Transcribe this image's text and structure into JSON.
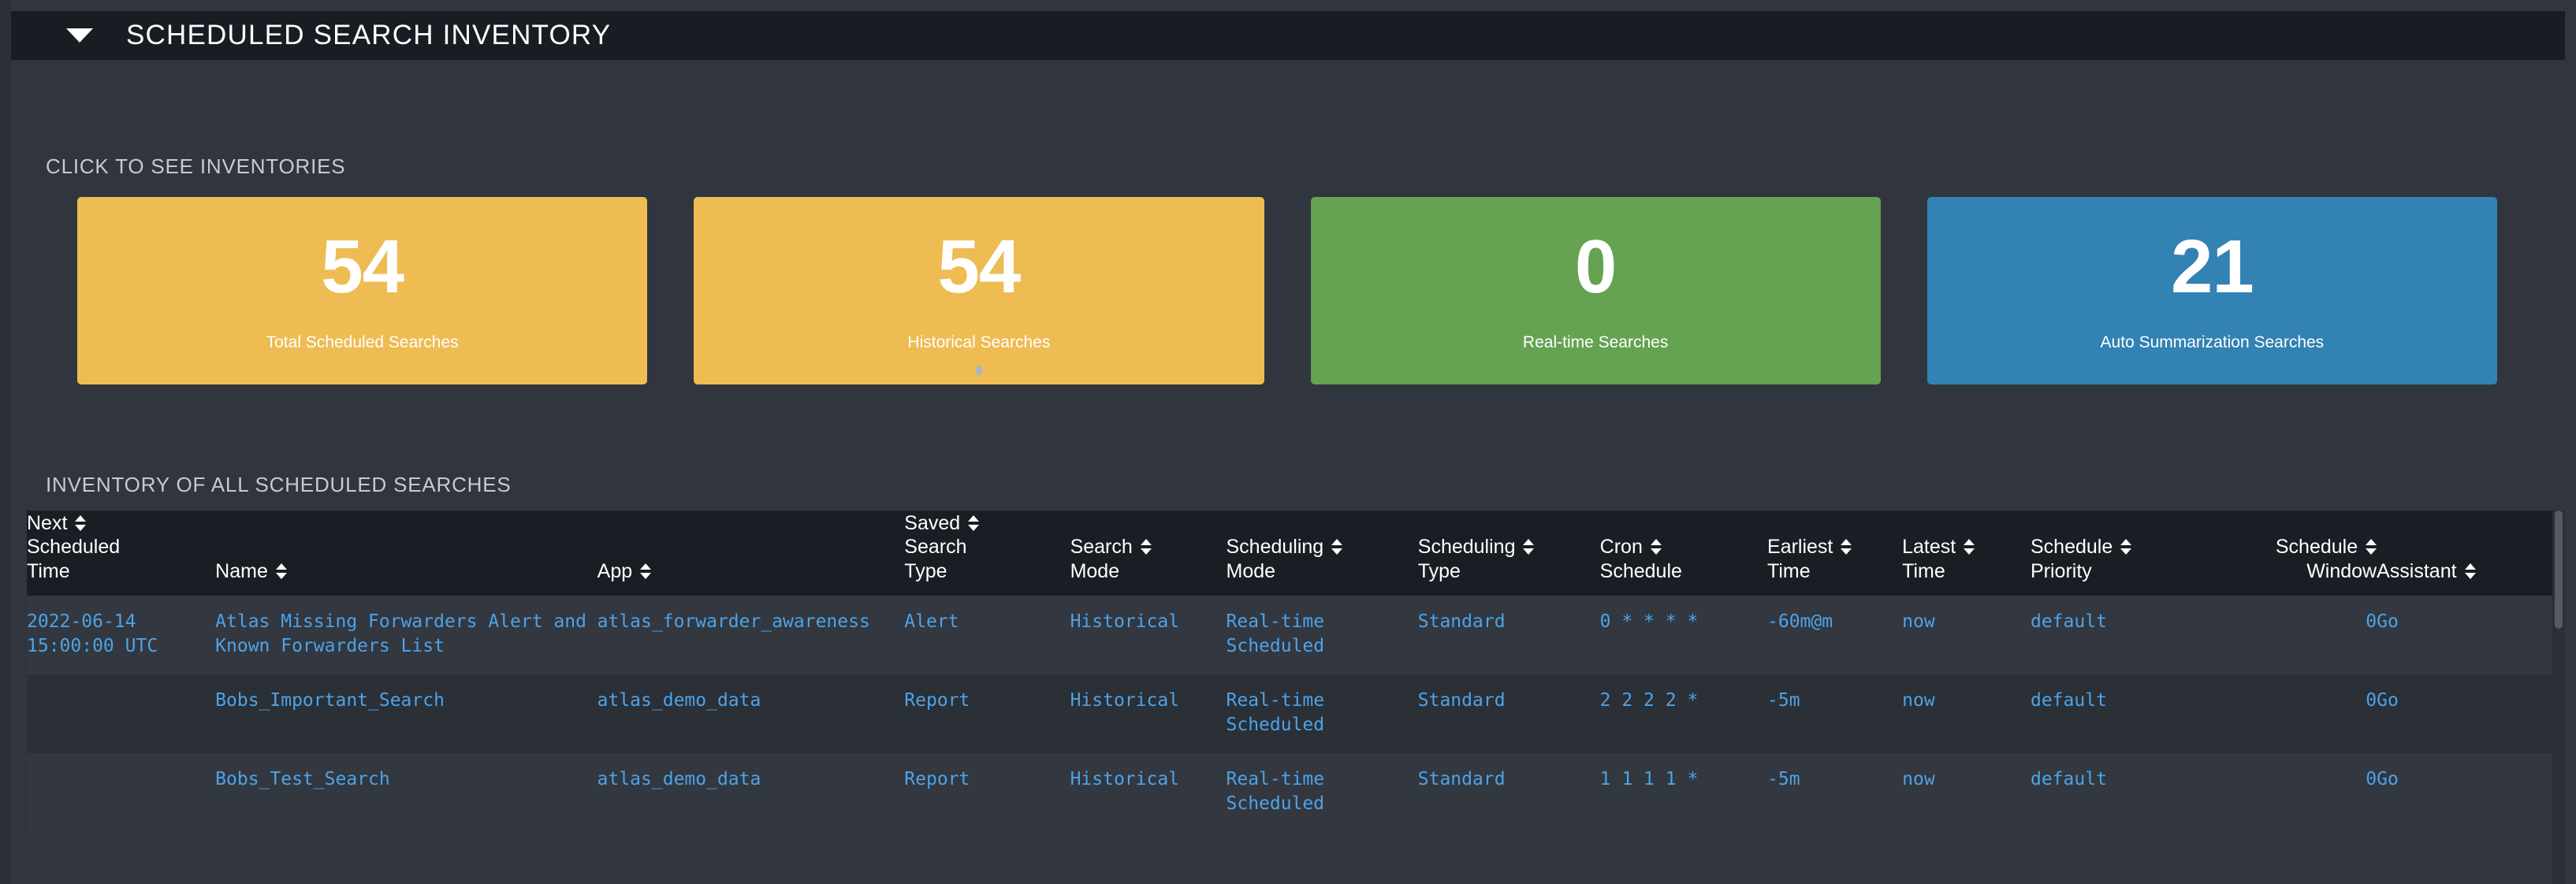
{
  "panel": {
    "title": "SCHEDULED SEARCH INVENTORY",
    "caret_icon": "triangle-down-icon"
  },
  "inventories_section": {
    "label": "CLICK TO SEE INVENTORIES",
    "cards": [
      {
        "value": "54",
        "label": "Total Scheduled Searches",
        "color": "#eebc53"
      },
      {
        "value": "54",
        "label": "Historical Searches",
        "color": "#eebc53"
      },
      {
        "value": "0",
        "label": "Real-time Searches",
        "color": "#65a252"
      },
      {
        "value": "21",
        "label": "Auto Summarization Searches",
        "color": "#3282b3"
      }
    ]
  },
  "table_section": {
    "label": "INVENTORY OF ALL SCHEDULED SEARCHES",
    "columns": [
      {
        "lines": [
          "Next",
          "Scheduled",
          "Time"
        ],
        "align": "left"
      },
      {
        "lines": [
          "Name"
        ],
        "align": "left"
      },
      {
        "lines": [
          "App"
        ],
        "align": "left"
      },
      {
        "lines": [
          "Saved",
          "Search",
          "Type"
        ],
        "align": "left"
      },
      {
        "lines": [
          "Search",
          "Mode"
        ],
        "align": "left"
      },
      {
        "lines": [
          "Scheduling",
          "Mode"
        ],
        "align": "left"
      },
      {
        "lines": [
          "Scheduling",
          "Type"
        ],
        "align": "left"
      },
      {
        "lines": [
          "Cron",
          "Schedule"
        ],
        "align": "left"
      },
      {
        "lines": [
          "Earliest",
          "Time"
        ],
        "align": "left"
      },
      {
        "lines": [
          "Latest",
          "Time"
        ],
        "align": "left"
      },
      {
        "lines": [
          "Schedule",
          "Priority"
        ],
        "align": "left"
      },
      {
        "lines": [
          "Schedule",
          "Window"
        ],
        "align": "right"
      },
      {
        "lines": [
          "Assistant"
        ],
        "align": "left"
      }
    ],
    "rows": [
      {
        "next_scheduled_time": "2022-06-14 15:00:00 UTC",
        "name": "Atlas Missing Forwarders Alert and Known Forwarders List",
        "app": "atlas_forwarder_awareness",
        "saved_search_type": "Alert",
        "search_mode": "Historical",
        "scheduling_mode": "Real-time Scheduled",
        "scheduling_type": "Standard",
        "cron_schedule": "0 * * * *",
        "earliest_time": "-60m@m",
        "latest_time": "now",
        "schedule_priority": "default",
        "schedule_window": "0",
        "assistant": "Go"
      },
      {
        "next_scheduled_time": "",
        "name": "Bobs_Important_Search",
        "app": "atlas_demo_data",
        "saved_search_type": "Report",
        "search_mode": "Historical",
        "scheduling_mode": "Real-time Scheduled",
        "scheduling_type": "Standard",
        "cron_schedule": "2 2 2 2 *",
        "earliest_time": "-5m",
        "latest_time": "now",
        "schedule_priority": "default",
        "schedule_window": "0",
        "assistant": "Go"
      },
      {
        "next_scheduled_time": "",
        "name": "Bobs_Test_Search",
        "app": "atlas_demo_data",
        "saved_search_type": "Report",
        "search_mode": "Historical",
        "scheduling_mode": "Real-time Scheduled",
        "scheduling_type": "Standard",
        "cron_schedule": "1 1 1 1 *",
        "earliest_time": "-5m",
        "latest_time": "now",
        "schedule_priority": "default",
        "schedule_window": "0",
        "assistant": "Go"
      }
    ]
  }
}
